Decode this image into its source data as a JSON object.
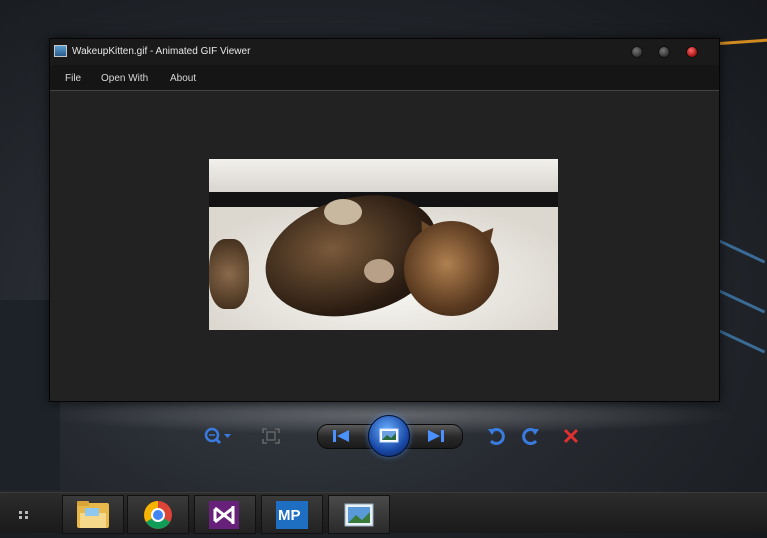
{
  "window": {
    "title": "WakeupKitten.gif - Animated GIF Viewer"
  },
  "menu": {
    "items": [
      "File",
      "Open With",
      "About"
    ]
  },
  "image": {
    "file_name": "WakeupKitten.gif"
  },
  "toolbar": {
    "icons": [
      "zoom-icon",
      "fit-to-window-icon",
      "previous-icon",
      "slideshow-icon",
      "next-icon",
      "rotate-left-icon",
      "rotate-right-icon",
      "delete-icon"
    ]
  },
  "taskbar": {
    "items": [
      "file-explorer",
      "chrome",
      "visual-studio",
      "mp",
      "photo-viewer"
    ],
    "mp_label": "MP"
  },
  "colors": {
    "accent_blue": "#3a7be0",
    "delete_red": "#e03030",
    "window_bg": "#222222"
  }
}
